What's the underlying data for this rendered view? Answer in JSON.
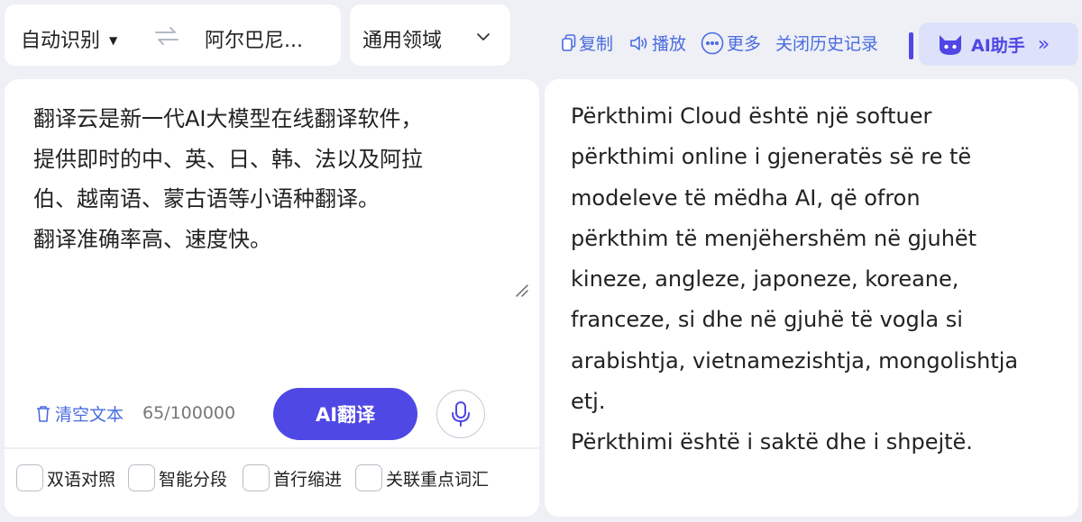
{
  "top_bar": {
    "source_language": "自动识别",
    "target_language": "阿尔巴尼...",
    "domain": "通用领域",
    "tools": {
      "copy": "复制",
      "play": "播放",
      "more": "更多",
      "close_history": "关闭历史记录"
    },
    "ai_assistant": "AI助手"
  },
  "source": {
    "text": "翻译云是新一代AI大模型在线翻译软件，\n提供即时的中、英、日、韩、法以及阿拉\n伯、越南语、蒙古语等小语种翻译。\n翻译准确率高、速度快。",
    "clear_label": "清空文本",
    "char_count": "65/100000",
    "translate_button": "AI翻译"
  },
  "options": [
    {
      "label": "双语对照",
      "checked": false
    },
    {
      "label": "智能分段",
      "checked": false
    },
    {
      "label": "首行缩进",
      "checked": false
    },
    {
      "label": "关联重点词汇",
      "checked": false
    }
  ],
  "target": {
    "text": "Përkthimi Cloud është një softuer\npërkthimi online i gjeneratës së re të\nmodeleve të mëdha AI, që ofron\npërkthim të menjëhershëm në gjuhët\nkineze, angleze, japoneze, koreane,\nfranceze, si dhe në gjuhë të vogla si\narabishtja, vietnamezishtja, mongolishtja\netj.\nPërkthimi është i saktë dhe i shpejtë."
  },
  "colors": {
    "accent": "#5048e5",
    "link": "#4a6bdf",
    "background": "#eef0f6"
  }
}
